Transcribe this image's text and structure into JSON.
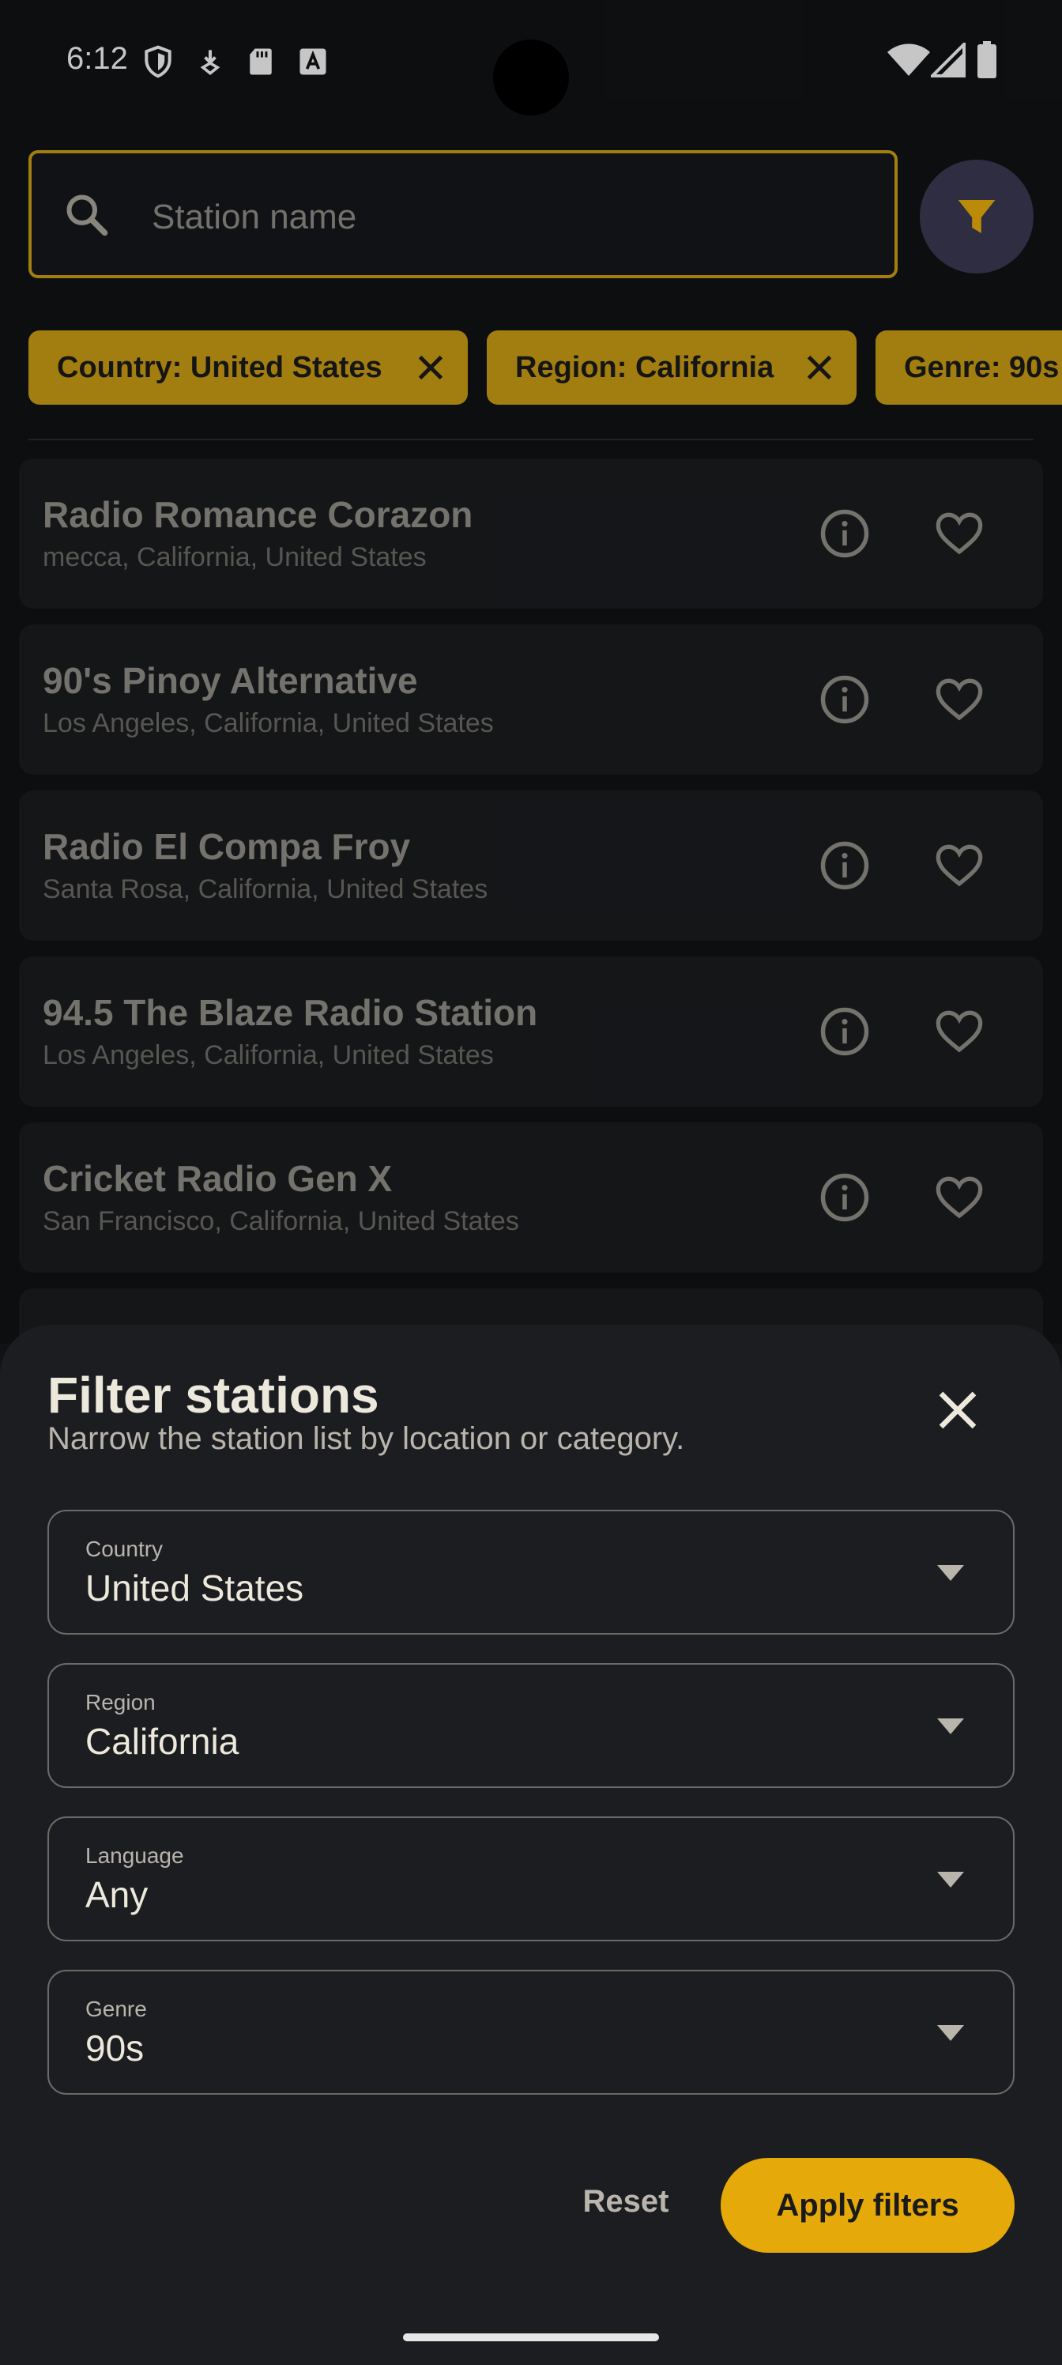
{
  "status_bar": {
    "time": "6:12",
    "left_icons": [
      "shield-icon",
      "download-icon",
      "sd-card-icon",
      "font-a-icon"
    ],
    "right_icons": [
      "wifi-icon",
      "cell-signal-icon",
      "battery-icon"
    ]
  },
  "search": {
    "placeholder": "Station name",
    "value": ""
  },
  "chips": [
    {
      "label": "Country: United States"
    },
    {
      "label": "Region: California"
    },
    {
      "label": "Genre: 90s"
    }
  ],
  "stations": [
    {
      "name": "Radio Romance Corazon",
      "location": "mecca, California, United States"
    },
    {
      "name": "90's Pinoy Alternative",
      "location": "Los Angeles, California, United States"
    },
    {
      "name": "Radio El Compa Froy",
      "location": "Santa Rosa, California, United States"
    },
    {
      "name": "94.5 The Blaze Radio Station",
      "location": "Los Angeles, California, United States"
    },
    {
      "name": "Cricket Radio Gen X",
      "location": "San Francisco, California, United States"
    }
  ],
  "sheet": {
    "title": "Filter stations",
    "subtitle": "Narrow the station list by location or category.",
    "fields": [
      {
        "label": "Country",
        "value": "United States"
      },
      {
        "label": "Region",
        "value": "California"
      },
      {
        "label": "Language",
        "value": "Any"
      },
      {
        "label": "Genre",
        "value": "90s"
      }
    ],
    "reset_label": "Reset",
    "apply_label": "Apply filters"
  },
  "colors": {
    "accent": "#E5A90A",
    "chip": "#C69A14",
    "background": "#111214",
    "sheet": "#1C1D20",
    "filter_button": "#3A3850"
  }
}
